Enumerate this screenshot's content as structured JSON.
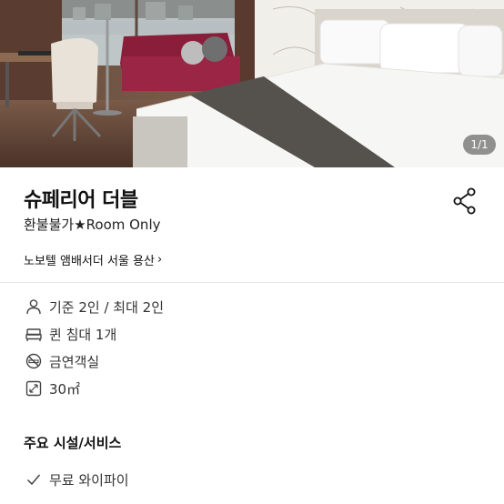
{
  "gallery": {
    "counter": "1/1"
  },
  "room": {
    "name": "슈페리어 더블",
    "subtitle": "환불불가★Room Only"
  },
  "hotel": {
    "name": "노보텔 앰배서더 서울 용산",
    "chevron": "›"
  },
  "details": [
    {
      "icon": "person-icon",
      "text": "기준 2인 / 최대 2인"
    },
    {
      "icon": "bed-icon",
      "text": "퀸 침대 1개"
    },
    {
      "icon": "no-smoking-icon",
      "text": "금연객실"
    },
    {
      "icon": "area-icon",
      "text": "30㎡"
    }
  ],
  "amenities": {
    "title": "주요 시설/서비스",
    "items": [
      {
        "icon": "check-icon",
        "text": "무료 와이파이"
      }
    ]
  }
}
